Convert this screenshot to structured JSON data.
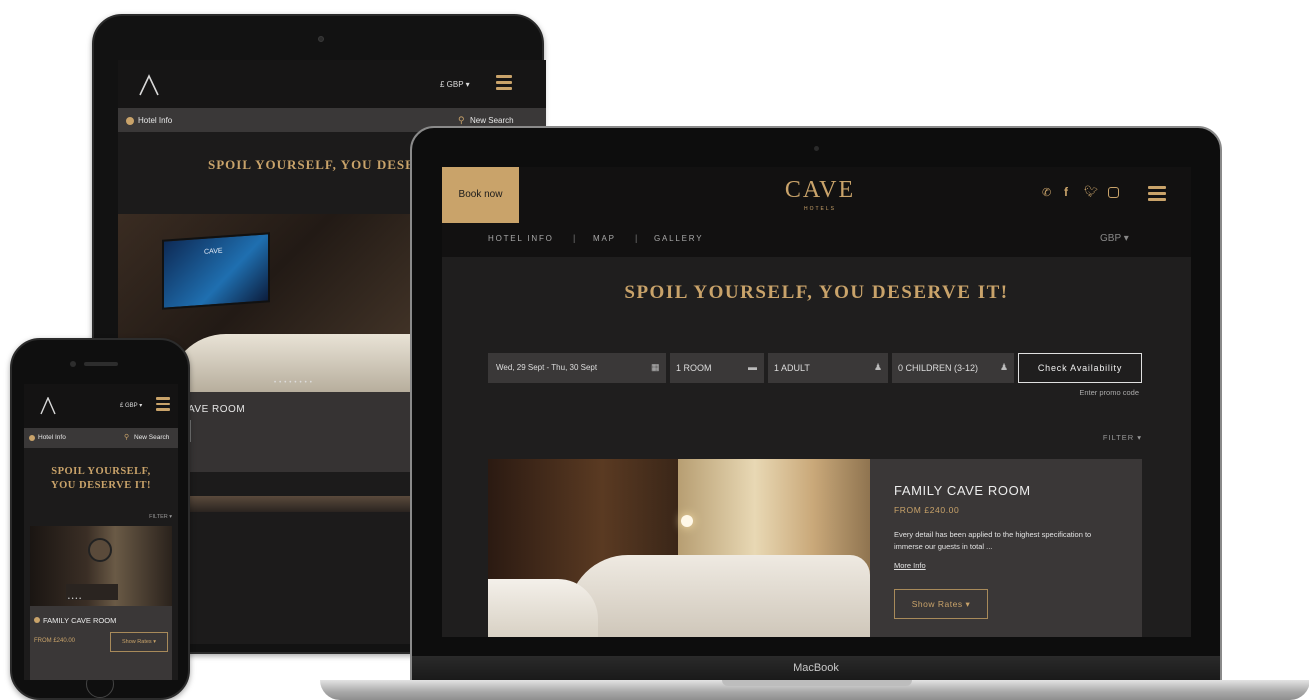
{
  "colors": {
    "gold": "#c9a36a",
    "dark": "#1c1b1b",
    "panel": "#3a3737",
    "bar": "#2d2c2c"
  },
  "tablet": {
    "currency": "£ GBP ▾",
    "hotel_info": "Hotel Info",
    "new_search": "New Search",
    "heading": "SPOIL YOURSELF, YOU DESERVE",
    "room_title": "AVE ROOM",
    "tv_logo": "CAVE"
  },
  "phone": {
    "currency": "£ GBP ▾",
    "hotel_info": "Hotel Info",
    "new_search": "New Search",
    "heading": "SPOIL YOURSELF, YOU DESERVE IT!",
    "filter": "FILTER ▾",
    "room_title": "FAMILY CAVE ROOM",
    "price": "FROM £240.00",
    "show_rates": "Show Rates ▾"
  },
  "laptop": {
    "book_now": "Book now",
    "logo": "CAVE",
    "logo_sub": "HOTELS",
    "nav": [
      "HOTEL INFO",
      "MAP",
      "GALLERY"
    ],
    "nav_sep": "|",
    "currency": "GBP ▾",
    "heading": "SPOIL YOURSELF, YOU DESERVE IT!",
    "dates": "Wed, 29 Sept - Thu, 30 Sept",
    "rooms": "1 ROOM",
    "adults": "1 ADULT",
    "children": "0 CHILDREN (3-12)",
    "check": "Check Availability",
    "promo": "Enter promo code",
    "filter": "FILTER ▾",
    "room_title": "FAMILY CAVE ROOM",
    "price": "FROM £240.00",
    "description": "Every detail has been applied to the highest specification to immerse our guests in total ...",
    "more_info": "More Info",
    "show_rates": "Show Rates ▾",
    "brand": "MacBook"
  }
}
